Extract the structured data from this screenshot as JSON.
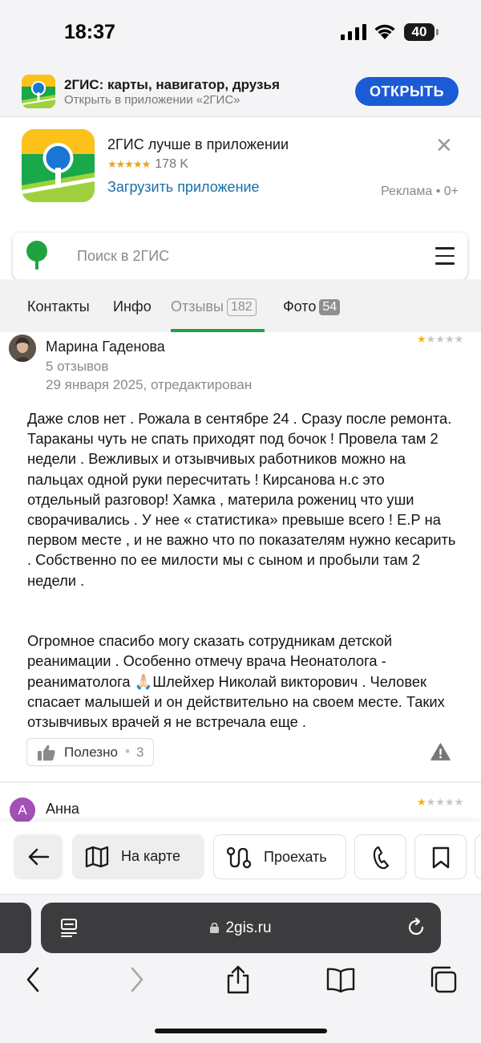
{
  "status": {
    "time": "18:37",
    "battery": "40"
  },
  "smart_banner": {
    "title": "2ГИС: карты, навигатор, друзья",
    "subtitle": "Открыть в приложении «2ГИС»",
    "open_label": "ОТКРЫТЬ",
    "accent": "#1c5bd6"
  },
  "promo": {
    "title": "2ГИС лучше в приложении",
    "stars": "★★★★★",
    "rating_count": "178 K",
    "link": "Загрузить приложение",
    "ad_label": "Реклама • 0+",
    "close_icon": "close-icon"
  },
  "search": {
    "placeholder": "Поиск в 2ГИС"
  },
  "tabs": [
    {
      "label": "Контакты"
    },
    {
      "label": "Инфо"
    },
    {
      "label": "Отзывы",
      "count": "182"
    },
    {
      "label": "Фото",
      "count": "54"
    }
  ],
  "active_tab": "Отзывы",
  "review": {
    "author": "Марина Гаденова",
    "reviews_count": "5 отзывов",
    "date": "29 января 2025, отредактирован",
    "rating": 1,
    "text": "Даже слов нет . Рожала в сентябре 24 . Сразу после ремонта. Тараканы чуть не спать приходят под бочок ! Провела там 2 недели . Вежливых и отзывчивых работников можно на пальцах одной руки пересчитать ! Кирсанова н.с это отдельный разговор! Хамка , материла рожениц что уши сворачивались . У нее « статистика» превыше всего ! Е.Р на первом месте , и не важно что по показателям нужно кесарить . Собственно по ее милости мы с сыном и пробыли там 2 недели .\n\n\nОгромное спасибо могу сказать сотрудникам детской реанимации . Особенно отмечу врача Неонатолога - реаниматолога 🙏🏻Шлейхер Николай викторович . Человек спасает малышей и он действительно на своем месте. Таких отзывчивых врачей я не встречала еще .",
    "like_label": "Полезно",
    "like_sep": "•",
    "like_count": "3"
  },
  "review2": {
    "author": "Анна",
    "avatar_letter": "А",
    "rating": 1
  },
  "actions": {
    "back_icon": "arrow-left-icon",
    "map_label": "На карте",
    "route_label": "Проехать",
    "call_icon": "phone-icon",
    "bookmark_icon": "bookmark-icon"
  },
  "browser": {
    "url": "2gis.ru"
  },
  "colors": {
    "green": "#1ea34a",
    "star": "#f5b301",
    "link": "#1a6fa8"
  }
}
